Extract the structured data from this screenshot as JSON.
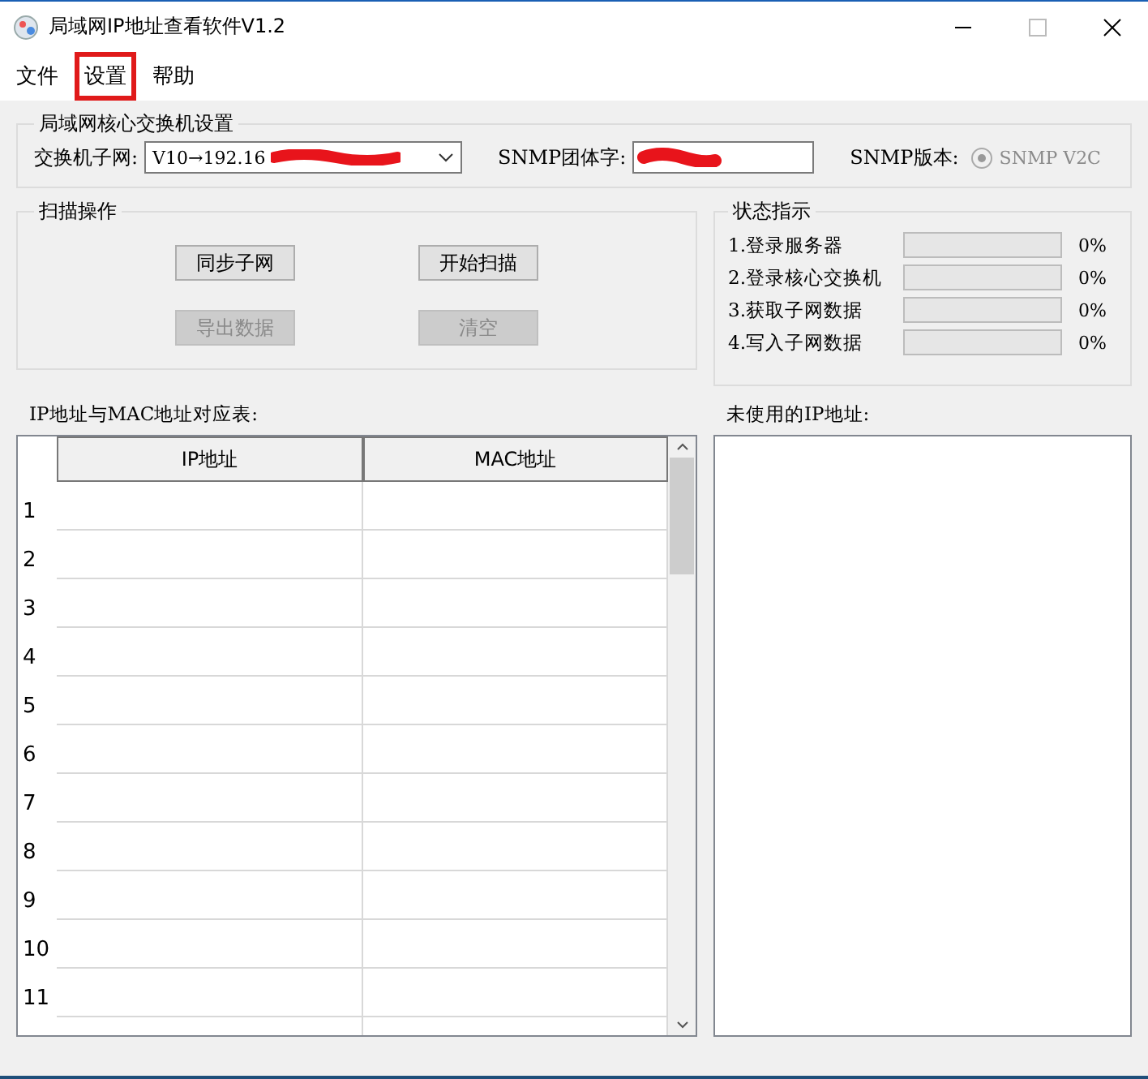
{
  "window": {
    "title": "局域网IP地址查看软件V1.2"
  },
  "menu": [
    {
      "label": "文件",
      "highlighted": false
    },
    {
      "label": "设置",
      "highlighted": true
    },
    {
      "label": "帮助",
      "highlighted": false
    }
  ],
  "switch_group": {
    "title": "局域网核心交换机设置",
    "subnet_label": "交换机子网:",
    "subnet_value": "V10→192.16",
    "subnet_redacted": true,
    "community_label": "SNMP团体字:",
    "community_redacted": true,
    "version_label": "SNMP版本:",
    "version_option": {
      "label": "SNMP V2C",
      "selected": true,
      "disabled": true
    }
  },
  "scan_group": {
    "title": "扫描操作",
    "buttons": [
      {
        "label": "同步子网",
        "disabled": false
      },
      {
        "label": "开始扫描",
        "disabled": false
      },
      {
        "label": "导出数据",
        "disabled": true
      },
      {
        "label": "清空",
        "disabled": true
      }
    ]
  },
  "status_group": {
    "title": "状态指示",
    "items": [
      {
        "label": "1.登录服务器",
        "level": 0,
        "reading": "0%"
      },
      {
        "label": "2.登录核心交换机",
        "level": 0,
        "reading": "0%"
      },
      {
        "label": "3.获取子网数据",
        "level": 0,
        "reading": "0%"
      },
      {
        "label": "4.写入子网数据",
        "level": 0,
        "reading": "0%"
      }
    ]
  },
  "table": {
    "title": "IP地址与MAC地址对应表:",
    "columns": [
      "IP地址",
      "MAC地址"
    ],
    "rows": [
      "1",
      "2",
      "3",
      "4",
      "5",
      "6",
      "7",
      "8",
      "9",
      "10",
      "11"
    ]
  },
  "unused": {
    "title": "未使用的IP地址:"
  }
}
